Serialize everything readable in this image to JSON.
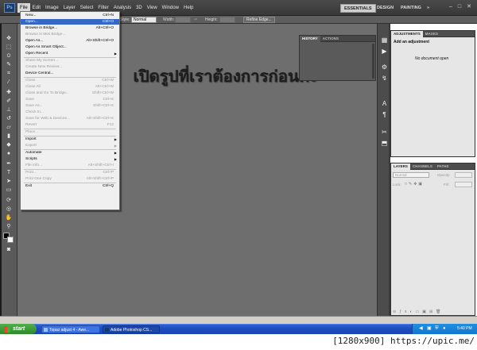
{
  "menubar": {
    "logo": "Ps",
    "items": [
      "File",
      "Edit",
      "Image",
      "Layer",
      "Select",
      "Filter",
      "Analysis",
      "3D",
      "View",
      "Window",
      "Help"
    ],
    "workspaces": [
      "ESSENTIALS",
      "DESIGN",
      "PAINTING"
    ],
    "workspace_more": "»",
    "window_controls": [
      "–",
      "□",
      "✕"
    ]
  },
  "options_bar": {
    "style_label": "Style:",
    "style_value": "Normal",
    "width_label": "Width:",
    "height_label": "Height:",
    "refine_edge": "Refine Edge..."
  },
  "file_menu": {
    "items": [
      {
        "label": "New...",
        "shortcut": "Ctrl+N",
        "state": "enabled"
      },
      {
        "label": "Open...",
        "shortcut": "Ctrl+O",
        "state": "highlighted"
      },
      {
        "label": "Browse in Bridge...",
        "shortcut": "Alt+Ctrl+O",
        "state": "enabled"
      },
      {
        "label": "Browse in Mini Bridge...",
        "shortcut": "",
        "state": "disabled"
      },
      {
        "label": "Open As...",
        "shortcut": "Alt+Shift+Ctrl+O",
        "state": "enabled"
      },
      {
        "label": "Open As Smart Object...",
        "shortcut": "",
        "state": "enabled"
      },
      {
        "label": "Open Recent",
        "shortcut": "",
        "state": "submenu"
      },
      {
        "label": "Share My Screen...",
        "shortcut": "",
        "state": "disabled"
      },
      {
        "label": "Create New Review...",
        "shortcut": "",
        "state": "disabled"
      },
      {
        "label": "Device Central...",
        "shortcut": "",
        "state": "enabled"
      },
      {
        "label": "Close",
        "shortcut": "Ctrl+W",
        "state": "disabled"
      },
      {
        "label": "Close All",
        "shortcut": "Alt+Ctrl+W",
        "state": "disabled"
      },
      {
        "label": "Close and Go To Bridge...",
        "shortcut": "Shift+Ctrl+W",
        "state": "disabled"
      },
      {
        "label": "Save",
        "shortcut": "Ctrl+S",
        "state": "disabled"
      },
      {
        "label": "Save As...",
        "shortcut": "Shift+Ctrl+S",
        "state": "disabled"
      },
      {
        "label": "Check In...",
        "shortcut": "",
        "state": "disabled"
      },
      {
        "label": "Save for Web & Devices...",
        "shortcut": "Alt+Shift+Ctrl+S",
        "state": "disabled"
      },
      {
        "label": "Revert",
        "shortcut": "F12",
        "state": "disabled"
      },
      {
        "label": "Place...",
        "shortcut": "",
        "state": "disabled"
      },
      {
        "label": "Import",
        "shortcut": "",
        "state": "submenu"
      },
      {
        "label": "Export",
        "shortcut": "",
        "state": "submenu-disabled"
      },
      {
        "label": "Automate",
        "shortcut": "",
        "state": "submenu"
      },
      {
        "label": "Scripts",
        "shortcut": "",
        "state": "submenu"
      },
      {
        "label": "File Info...",
        "shortcut": "Alt+Shift+Ctrl+I",
        "state": "disabled"
      },
      {
        "label": "Print...",
        "shortcut": "Ctrl+P",
        "state": "disabled"
      },
      {
        "label": "Print One Copy",
        "shortcut": "Alt+Shift+Ctrl+P",
        "state": "disabled"
      },
      {
        "label": "Exit",
        "shortcut": "Ctrl+Q",
        "state": "enabled"
      }
    ]
  },
  "canvas": {
    "overlay_text": "เปิดรูปที่เราต้องการก่อนค่ะ"
  },
  "history_panel": {
    "tabs": [
      "HISTORY",
      "ACTIONS"
    ]
  },
  "adjustments_panel": {
    "tabs": [
      "ADJUSTMENTS",
      "MASKS"
    ],
    "heading": "Add an adjustment",
    "message": "No document open"
  },
  "layers_panel": {
    "tabs": [
      "LAYERS",
      "CHANNELS",
      "PATHS"
    ],
    "blend_mode": "Normal",
    "opacity_label": "Opacity:",
    "lock_label": "Lock:",
    "fill_label": "Fill:"
  },
  "taskbar": {
    "start_label": "start",
    "buttons": [
      "Topaz adjust 4 - Awe...",
      "Adobe Photoshop CS..."
    ],
    "clock": "5:40 PM"
  },
  "watermark": "[1280x900] https://upic.me/"
}
